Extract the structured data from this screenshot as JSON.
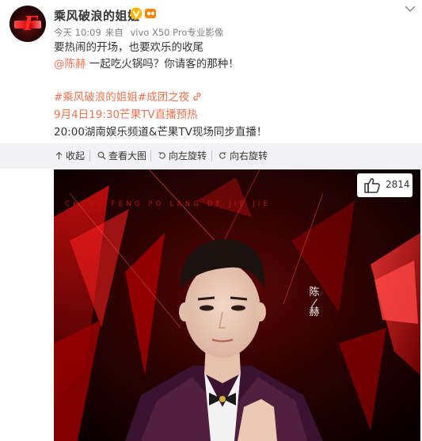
{
  "post": {
    "user_name": "乘风破浪的姐姐",
    "meta": {
      "time": "今天 10:09",
      "source_prefix": "来自",
      "source": "vivo X50 Pro专业影像"
    },
    "line1": "要热闹的开场，也要欢乐的收尾",
    "line2_mention": "@陈赫",
    "line2_text": " 一起吃火锅吗？你请客的那种！",
    "hashtag1": "#乘风破浪的姐姐#",
    "hashtag2": "成团之夜",
    "line4": "9月4日19:30芒果TV直播预热",
    "line5": "20:00湖南娱乐频道&芒果TV现场同步直播！"
  },
  "toolbar": {
    "collapse": "收起",
    "view_large": "查看大图",
    "rotate_left": "向左旋转",
    "rotate_right": "向右旋转"
  },
  "photo": {
    "like_count": "2814",
    "pinyin": "CHENG FENG PO LANG DE JIE JIE",
    "name_char1": "陈",
    "name_char2": "赫"
  },
  "colors": {
    "link": "#eb7350",
    "toolbar_bg": "#f2f2f5",
    "accent_red": "#c40000"
  }
}
